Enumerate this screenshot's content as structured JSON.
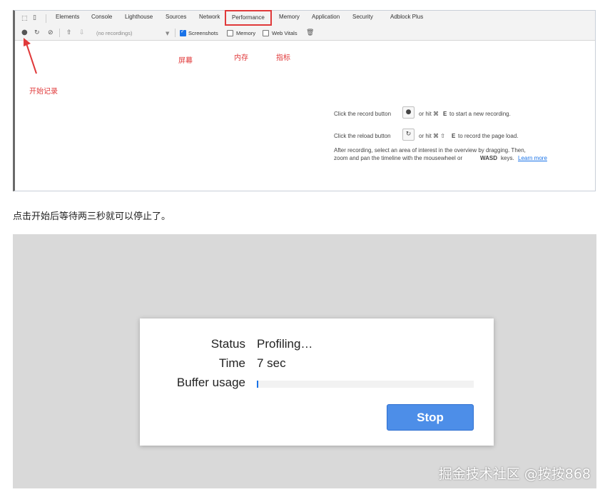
{
  "devtools": {
    "tabs": [
      "Elements",
      "Console",
      "Lighthouse",
      "Sources",
      "Network",
      "Performance",
      "Memory",
      "Application",
      "Security",
      "Adblock Plus"
    ],
    "active_tab": "Performance",
    "toolbar": {
      "recordings_placeholder": "(no recordings)",
      "screenshots_label": "Screenshots",
      "screenshots_checked": true,
      "memory_label": "Memory",
      "memory_checked": false,
      "webvitals_label": "Web Vitals",
      "webvitals_checked": false
    },
    "annotations": {
      "record": "开始记录",
      "screenshots": "屏幕",
      "memory": "内存",
      "metrics": "指标"
    },
    "hints": {
      "record_prefix": "Click the record button",
      "record_suffix_a": "or hit ⌘",
      "record_key": "E",
      "record_suffix_b": "to start a new recording.",
      "reload_prefix": "Click the reload button",
      "reload_suffix_a": "or hit ⌘ ⇧",
      "reload_key": "E",
      "reload_suffix_b": "to record the page load.",
      "after_line1": "After recording, select an area of interest in the overview by dragging. Then,",
      "after_line2a": "zoom and pan the timeline with the mousewheel or",
      "after_key": "WASD",
      "after_line2b": "keys.",
      "learn_more": "Learn more"
    }
  },
  "paragraph": "点击开始后等待两三秒就可以停止了。",
  "profiling": {
    "status_label": "Status",
    "status_value": "Profiling…",
    "time_label": "Time",
    "time_value": "7 sec",
    "buffer_label": "Buffer usage",
    "buffer_fraction": 0.005,
    "stop_label": "Stop"
  },
  "watermark": "掘金技术社区 @按按868",
  "colors": {
    "accent_red": "#e0393a",
    "link_blue": "#1a73e8",
    "stop_button": "#4d8ee8"
  }
}
